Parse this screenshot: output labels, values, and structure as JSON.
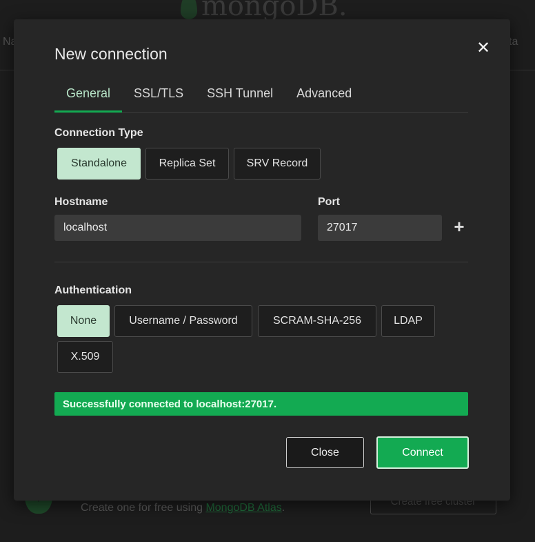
{
  "background": {
    "logo_text": "mongoDB.",
    "nav_left": "Na",
    "nav_right": "ta",
    "create_text": "Create one for free using ",
    "atlas_link": "MongoDB Atlas",
    "create_suffix": ".",
    "cluster_button": "Create free cluster"
  },
  "modal": {
    "title": "New connection",
    "close_icon": "✕",
    "tabs": [
      {
        "label": "General",
        "active": true
      },
      {
        "label": "SSL/TLS"
      },
      {
        "label": "SSH Tunnel"
      },
      {
        "label": "Advanced"
      }
    ],
    "connection_type": {
      "label": "Connection Type",
      "options": [
        "Standalone",
        "Replica Set",
        "SRV Record"
      ],
      "selected": "Standalone"
    },
    "hostname": {
      "label": "Hostname",
      "value": "localhost"
    },
    "port": {
      "label": "Port",
      "value": "27017"
    },
    "add_icon": "+",
    "authentication": {
      "label": "Authentication",
      "options": [
        "None",
        "Username / Password",
        "SCRAM-SHA-256",
        "LDAP",
        "X.509"
      ],
      "selected": "None"
    },
    "status_message": "Successfully connected to localhost:27017.",
    "close_button": "Close",
    "connect_button": "Connect"
  },
  "colors": {
    "accent": "#13aa52",
    "selected_option": "#c3e7cf"
  }
}
